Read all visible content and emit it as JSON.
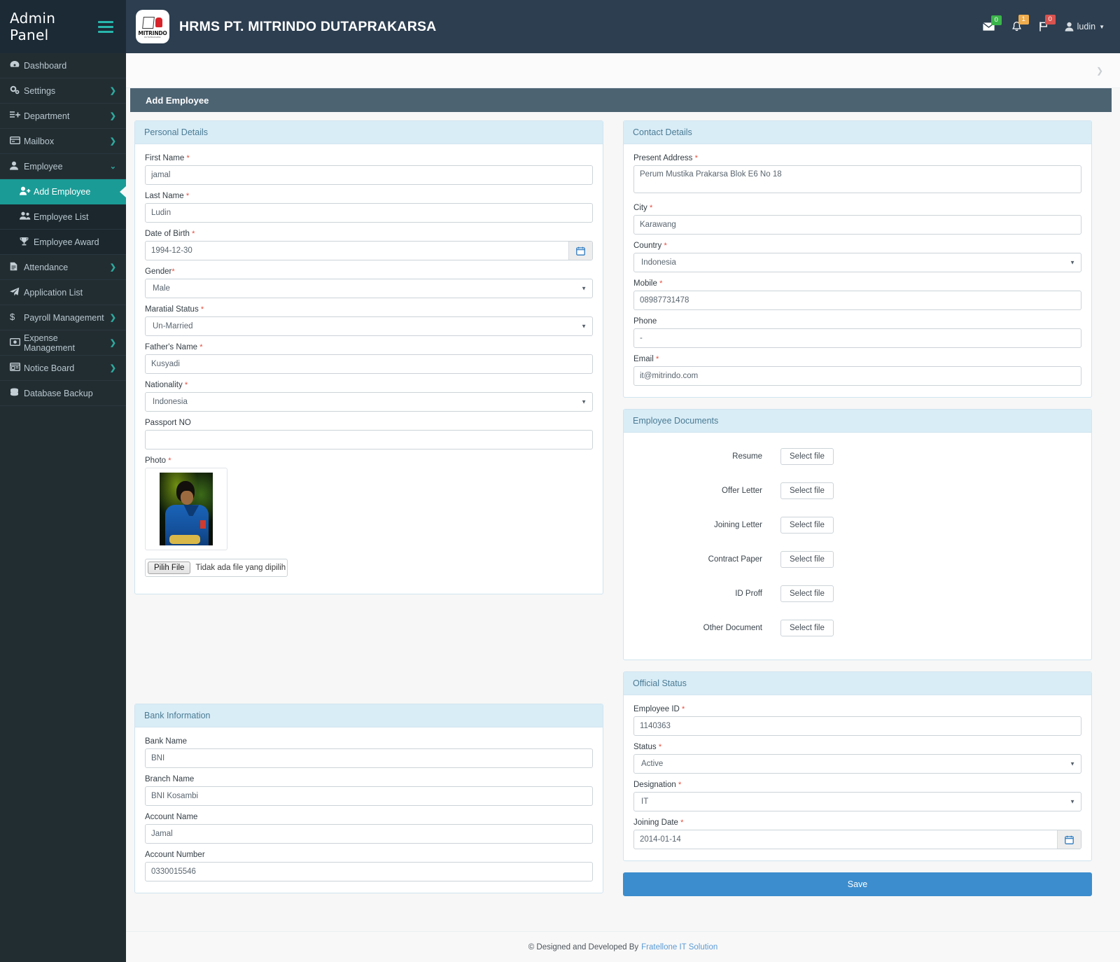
{
  "sidebar": {
    "brand": "Admin Panel",
    "items": [
      {
        "label": "Dashboard",
        "icon": "dashboard-icon",
        "caret": "",
        "sub": false,
        "active": false
      },
      {
        "label": "Settings",
        "icon": "gears-icon",
        "caret": "❯",
        "sub": false,
        "active": false
      },
      {
        "label": "Department",
        "icon": "list-add-icon",
        "caret": "❯",
        "sub": false,
        "active": false
      },
      {
        "label": "Mailbox",
        "icon": "mailbox-icon",
        "caret": "❯",
        "sub": false,
        "active": false
      },
      {
        "label": "Employee",
        "icon": "user-icon",
        "caret": "⌄",
        "sub": false,
        "active": false
      },
      {
        "label": "Add Employee",
        "icon": "user-plus-icon",
        "caret": "",
        "sub": true,
        "active": true
      },
      {
        "label": "Employee List",
        "icon": "users-icon",
        "caret": "",
        "sub": true,
        "active": false
      },
      {
        "label": "Employee Award",
        "icon": "trophy-icon",
        "caret": "",
        "sub": true,
        "active": false
      },
      {
        "label": "Attendance",
        "icon": "file-icon",
        "caret": "❯",
        "sub": false,
        "active": false
      },
      {
        "label": "Application List",
        "icon": "paper-plane-icon",
        "caret": "",
        "sub": false,
        "active": false
      },
      {
        "label": "Payroll Management",
        "icon": "dollar-icon",
        "caret": "❯",
        "sub": false,
        "active": false
      },
      {
        "label": "Expense Management",
        "icon": "money-icon",
        "caret": "❯",
        "sub": false,
        "active": false
      },
      {
        "label": "Notice Board",
        "icon": "notice-board-icon",
        "caret": "❯",
        "sub": false,
        "active": false
      },
      {
        "label": "Database Backup",
        "icon": "database-icon",
        "caret": "",
        "sub": false,
        "active": false
      }
    ]
  },
  "header": {
    "logo_name": "MITRINDO",
    "logo_sub": "DUTAPRAKARSA",
    "app_title": "HRMS PT. MITRINDO DUTAPRAKARSA",
    "messages_badge": "0",
    "notifications_badge": "1",
    "tasks_badge": "0",
    "user_name": "ludin",
    "breadcrumb_chevron": "❯"
  },
  "page": {
    "title": "Add Employee"
  },
  "personal": {
    "panel_title": "Personal Details",
    "first_name_label": "First Name",
    "first_name_value": "jamal",
    "last_name_label": "Last Name",
    "last_name_value": "Ludin",
    "dob_label": "Date of Birth",
    "dob_value": "1994-12-30",
    "gender_label": "Gender",
    "gender_value": "Male",
    "marital_label": "Maratial Status",
    "marital_value": "Un-Married",
    "father_label": "Father's Name",
    "father_value": "Kusyadi",
    "nationality_label": "Nationality",
    "nationality_value": "Indonesia",
    "passport_label": "Passport NO",
    "passport_value": "",
    "photo_label": "Photo",
    "file_button": "Pilih File",
    "file_status": "Tidak ada file yang dipilih"
  },
  "contact": {
    "panel_title": "Contact Details",
    "address_label": "Present Address",
    "address_value": "Perum Mustika Prakarsa Blok E6 No 18",
    "city_label": "City",
    "city_value": "Karawang",
    "country_label": "Country",
    "country_value": "Indonesia",
    "mobile_label": "Mobile",
    "mobile_value": "08987731478",
    "phone_label": "Phone",
    "phone_value": "-",
    "email_label": "Email",
    "email_value": "it@mitrindo.com"
  },
  "documents": {
    "panel_title": "Employee Documents",
    "select_file_label": "Select file",
    "rows": [
      {
        "label": "Resume"
      },
      {
        "label": "Offer Letter"
      },
      {
        "label": "Joining Letter"
      },
      {
        "label": "Contract Paper"
      },
      {
        "label": "ID Proff"
      },
      {
        "label": "Other Document"
      }
    ]
  },
  "bank": {
    "panel_title": "Bank Information",
    "bank_name_label": "Bank Name",
    "bank_name_value": "BNI",
    "branch_label": "Branch Name",
    "branch_value": "BNI Kosambi",
    "account_name_label": "Account Name",
    "account_name_value": "Jamal",
    "account_number_label": "Account Number",
    "account_number_value": "0330015546"
  },
  "official": {
    "panel_title": "Official Status",
    "employee_id_label": "Employee ID",
    "employee_id_value": "1140363",
    "status_label": "Status",
    "status_value": "Active",
    "designation_label": "Designation",
    "designation_value": "IT",
    "joining_label": "Joining Date",
    "joining_value": "2014-01-14",
    "save_label": "Save"
  },
  "footer": {
    "text": "© Designed and Developed By",
    "link": "Fratellone IT Solution"
  },
  "colors": {
    "sidebar_bg": "#222d32",
    "topbar_bg": "#2c3e50",
    "accent_teal": "#1a9b96",
    "panel_head_bg": "#d9edf7",
    "page_head_bg": "#4c6372",
    "save_blue": "#3c8dcd",
    "badge_green": "#3bb54a",
    "badge_orange": "#f0ad4e",
    "badge_red": "#d9534f",
    "required_red": "#e74c3c"
  }
}
